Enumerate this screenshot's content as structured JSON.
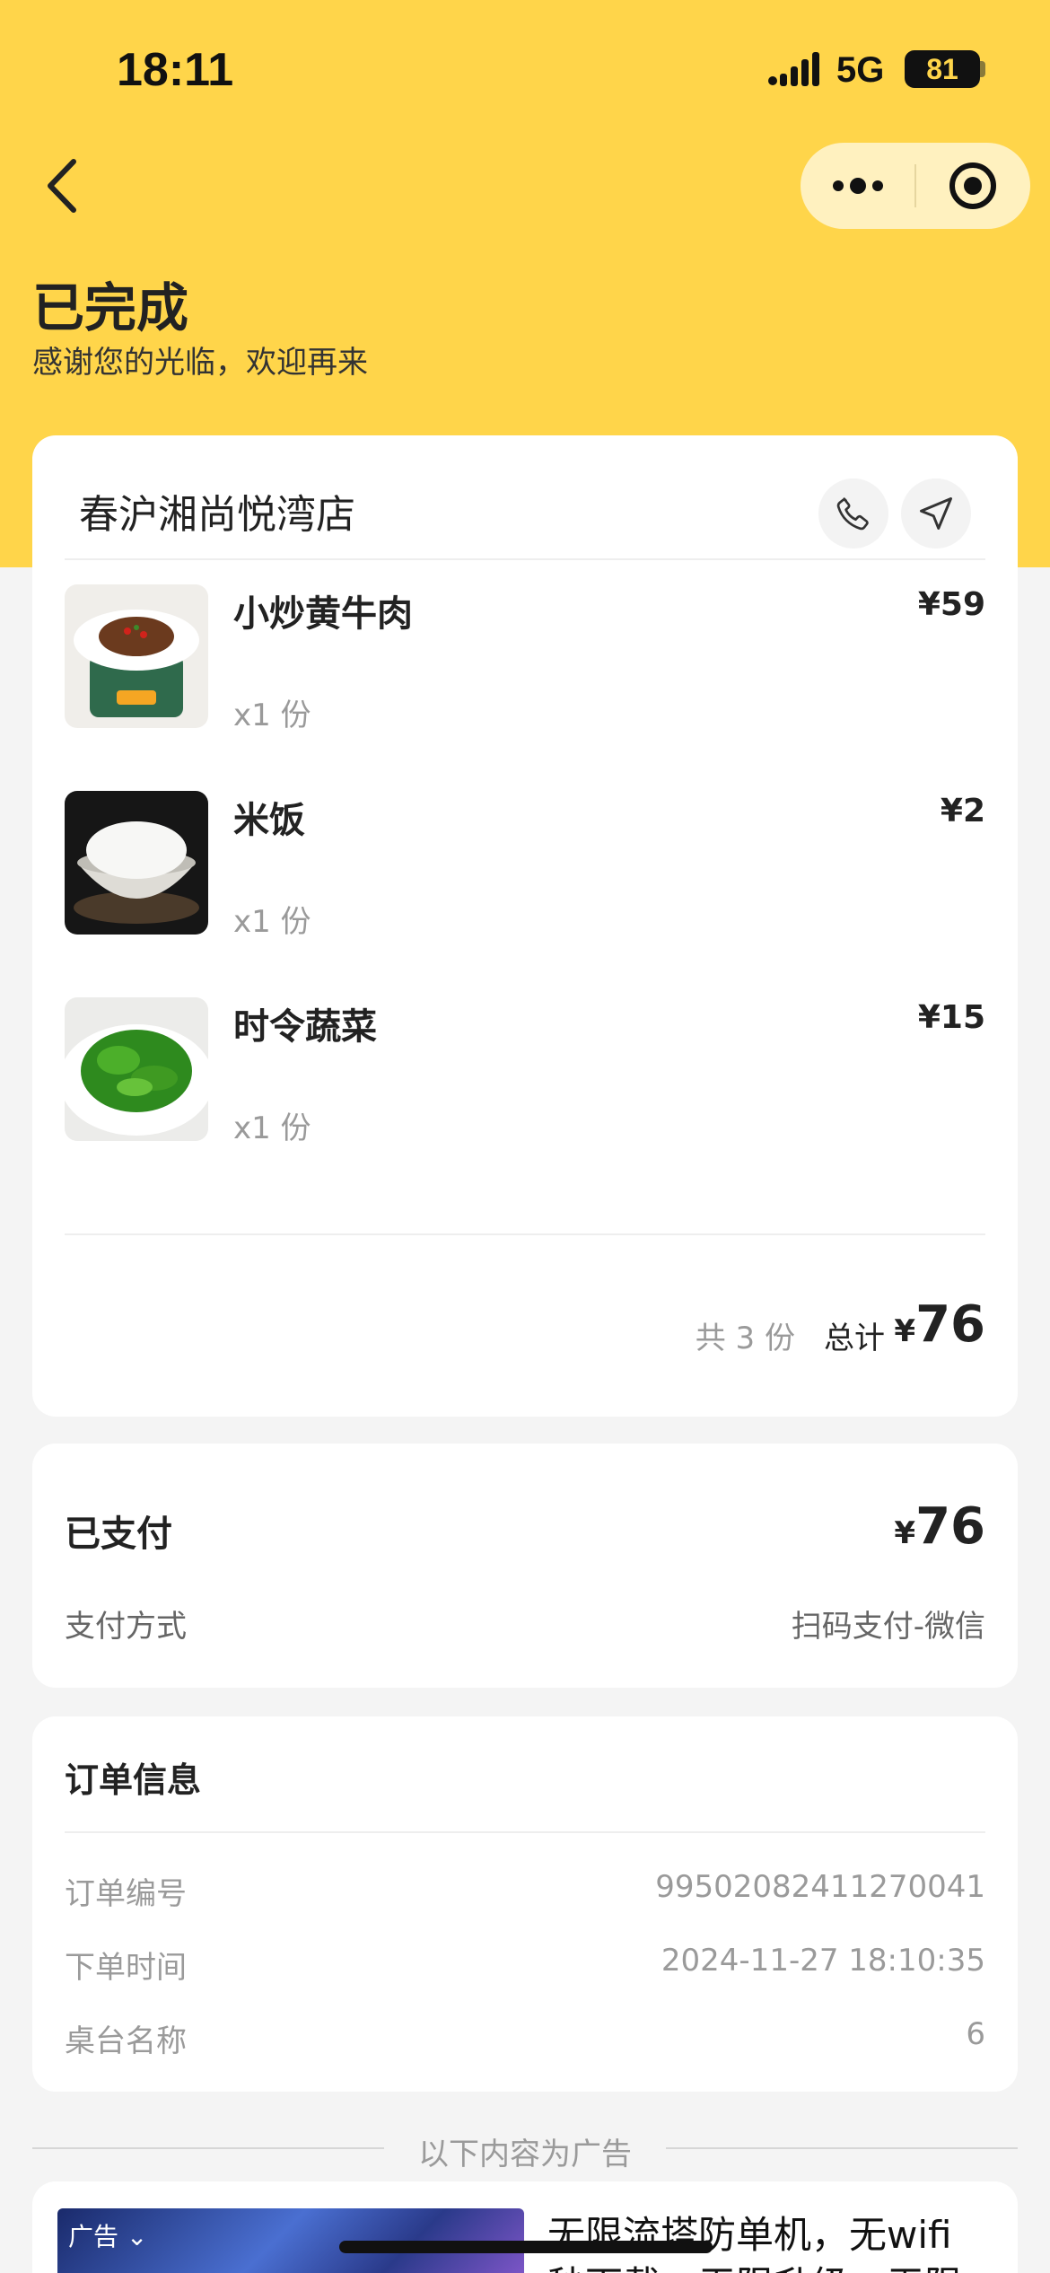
{
  "status_bar": {
    "time": "18:11",
    "network": "5G",
    "battery": "81"
  },
  "header": {
    "title": "已完成",
    "subtitle": "感谢您的光临，欢迎再来"
  },
  "store": {
    "name": "春沪湘尚悦湾店"
  },
  "items": [
    {
      "name": "小炒黄牛肉",
      "qty": "x1 份",
      "price": "¥59"
    },
    {
      "name": "米饭",
      "qty": "x1 份",
      "price": "¥2"
    },
    {
      "name": "时令蔬菜",
      "qty": "x1 份",
      "price": "¥15"
    }
  ],
  "summary": {
    "count": "共 3 份",
    "total_label": "总计",
    "currency": "¥",
    "total": "76"
  },
  "payment": {
    "paid_label": "已支付",
    "currency": "¥",
    "paid_amount": "76",
    "method_label": "支付方式",
    "method_value": "扫码支付-微信"
  },
  "order_info": {
    "title": "订单信息",
    "rows": [
      {
        "label": "订单编号",
        "value": "99502082411270041"
      },
      {
        "label": "下单时间",
        "value": "2024-11-27 18:10:35"
      },
      {
        "label": "桌台名称",
        "value": "6"
      }
    ]
  },
  "ad": {
    "separator": "以下内容为广告",
    "badge": "广告",
    "title_line1": "无限流塔防单机，无wifi",
    "title_line2": "秒下载，无限升级，无限"
  },
  "colors": {
    "brand_yellow": "#ffd54a",
    "capsule_bg": "#fff1bf",
    "background": "#f4f4f4"
  }
}
